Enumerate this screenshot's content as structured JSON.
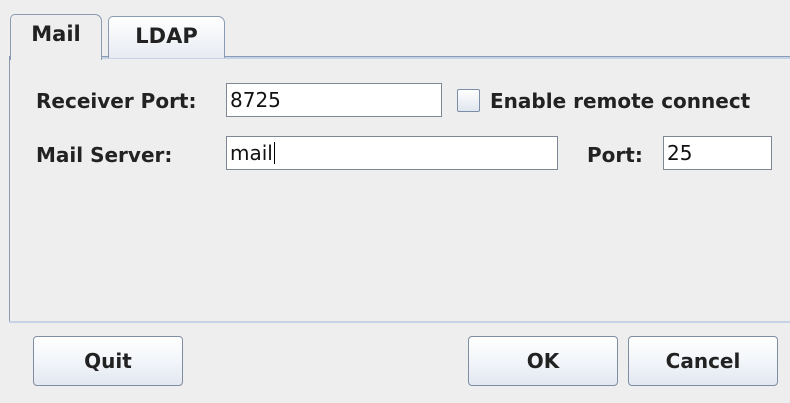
{
  "tabs": [
    {
      "label": "Mail",
      "active": true
    },
    {
      "label": "LDAP",
      "active": false
    }
  ],
  "mail": {
    "receiver_port_label": "Receiver Port:",
    "receiver_port_value": "8725",
    "enable_remote_label": "Enable remote connect",
    "enable_remote_checked": false,
    "mail_server_label": "Mail Server:",
    "mail_server_value": "mail",
    "port_label": "Port:",
    "port_value": "25"
  },
  "buttons": {
    "quit_label": "Quit",
    "ok_label": "OK",
    "cancel_label": "Cancel"
  },
  "colors": {
    "background": "#eeeeee",
    "tab_border": "#8a9bb3",
    "field_border": "#7f8795"
  }
}
